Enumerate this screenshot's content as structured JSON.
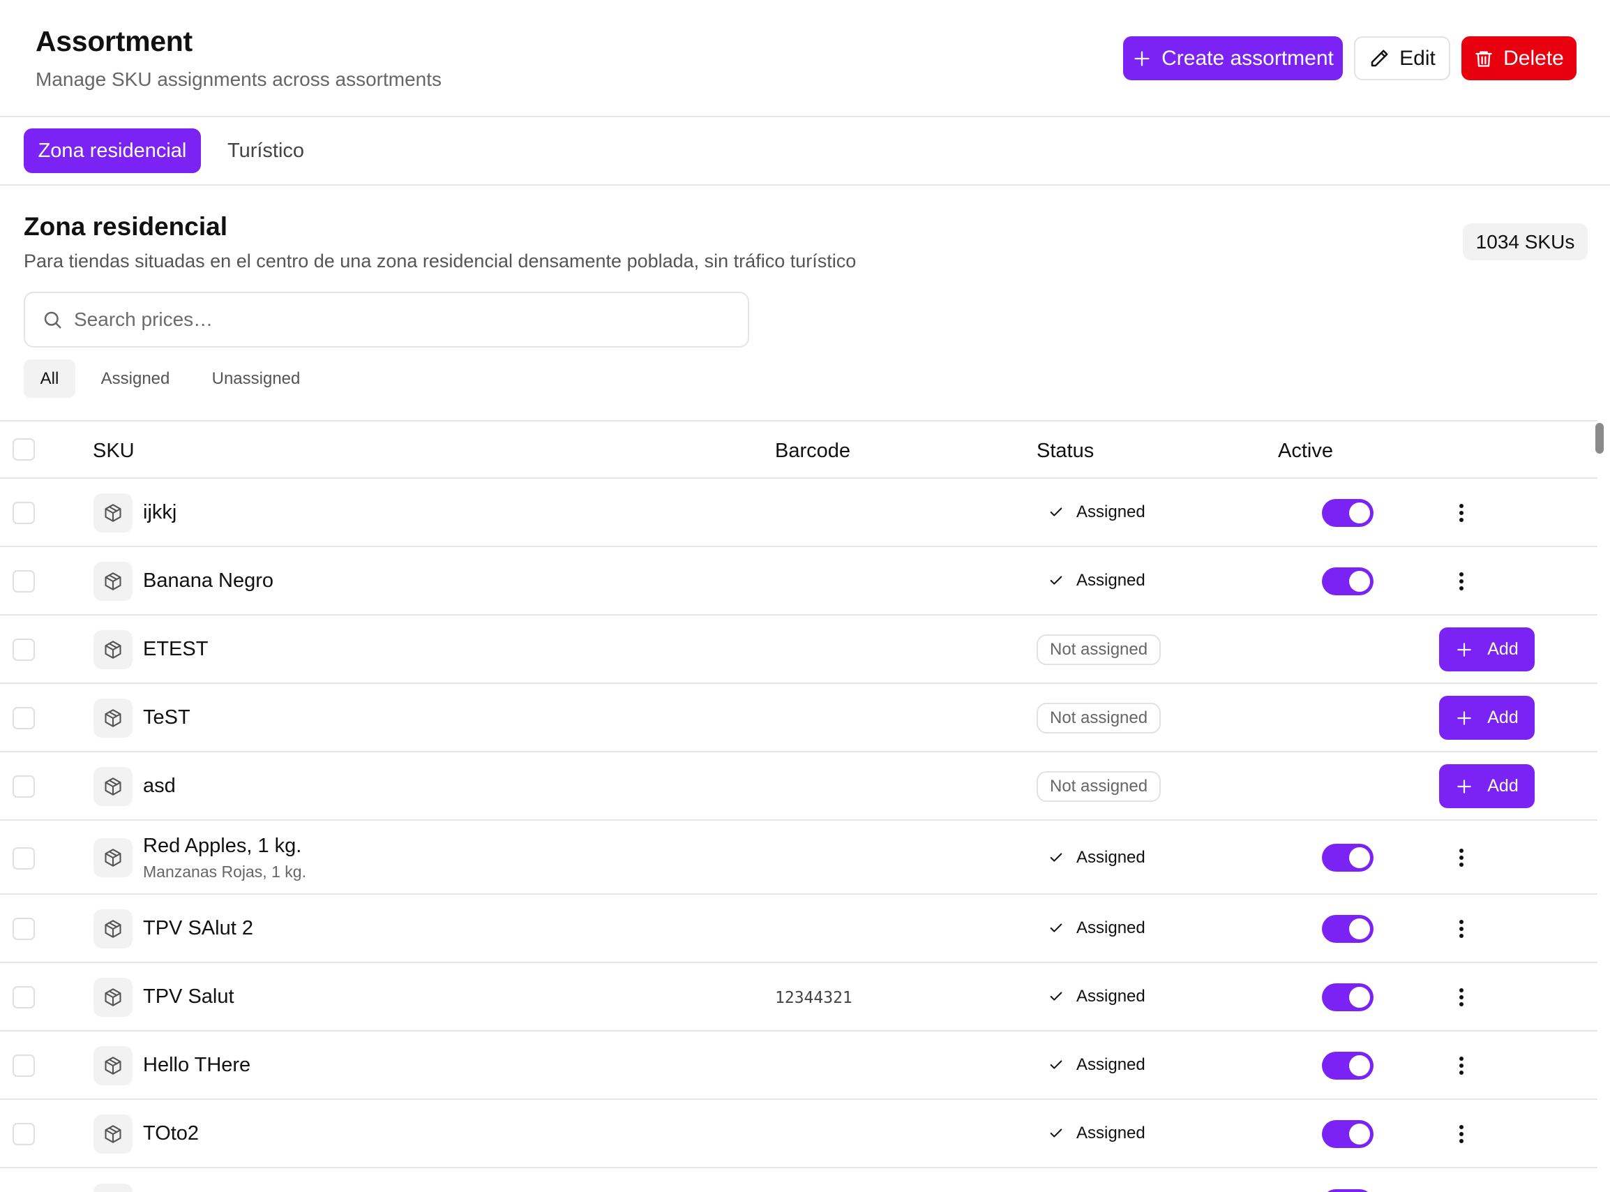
{
  "header": {
    "title": "Assortment",
    "subtitle": "Manage SKU assignments across assortments",
    "create_label": "Create assortment",
    "edit_label": "Edit",
    "delete_label": "Delete"
  },
  "tabs": [
    {
      "label": "Zona residencial",
      "active": true
    },
    {
      "label": "Turístico",
      "active": false
    }
  ],
  "section": {
    "title": "Zona residencial",
    "description": "Para tiendas situadas en el centro de una zona residencial densamente poblada, sin tráfico turístico",
    "sku_count": "1034 SKUs"
  },
  "search": {
    "placeholder": "Search prices…"
  },
  "filters": [
    "All",
    "Assigned",
    "Unassigned"
  ],
  "table": {
    "columns": {
      "sku": "SKU",
      "barcode": "Barcode",
      "status": "Status",
      "active": "Active"
    },
    "rows": [
      {
        "name": "ijkkj",
        "subtitle": "",
        "barcode": "",
        "status": "Assigned",
        "active": true
      },
      {
        "name": "Banana Negro",
        "subtitle": "",
        "barcode": "",
        "status": "Assigned",
        "active": true
      },
      {
        "name": "ETEST",
        "subtitle": "",
        "barcode": "",
        "status": "Not assigned",
        "action": "Add"
      },
      {
        "name": "TeST",
        "subtitle": "",
        "barcode": "",
        "status": "Not assigned",
        "action": "Add"
      },
      {
        "name": "asd",
        "subtitle": "",
        "barcode": "",
        "status": "Not assigned",
        "action": "Add"
      },
      {
        "name": "Red Apples, 1 kg.",
        "subtitle": "Manzanas Rojas, 1 kg.",
        "barcode": "",
        "status": "Assigned",
        "active": true
      },
      {
        "name": "TPV SAlut 2",
        "subtitle": "",
        "barcode": "",
        "status": "Assigned",
        "active": true
      },
      {
        "name": "TPV Salut",
        "subtitle": "",
        "barcode": "12344321",
        "status": "Assigned",
        "active": true
      },
      {
        "name": "Hello THere",
        "subtitle": "",
        "barcode": "",
        "status": "Assigned",
        "active": true
      },
      {
        "name": "TOto2",
        "subtitle": "",
        "barcode": "",
        "status": "Assigned",
        "active": true
      }
    ]
  },
  "colors": {
    "accent": "#7b22f5",
    "danger": "#e8000f",
    "border": "#e6e6e6"
  },
  "icons": [
    "plus-icon",
    "pencil-icon",
    "trash-icon",
    "search-icon",
    "package-icon",
    "check-icon",
    "more-vertical-icon"
  ]
}
